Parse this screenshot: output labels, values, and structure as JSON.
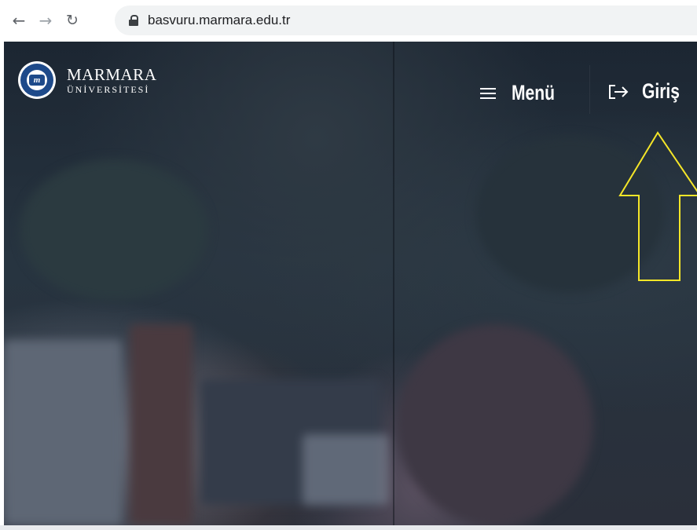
{
  "browser": {
    "url": "basvuru.marmara.edu.tr",
    "back_icon": "←",
    "forward_icon": "→",
    "reload_icon": "↻"
  },
  "header": {
    "brand_name": "MARMARA",
    "brand_subtitle": "ÜNİVERSİTESİ",
    "seal_letter": "m",
    "menu_label": "Menü",
    "login_label": "Giriş"
  },
  "annotation": {
    "arrow_color": "#f5e628"
  }
}
